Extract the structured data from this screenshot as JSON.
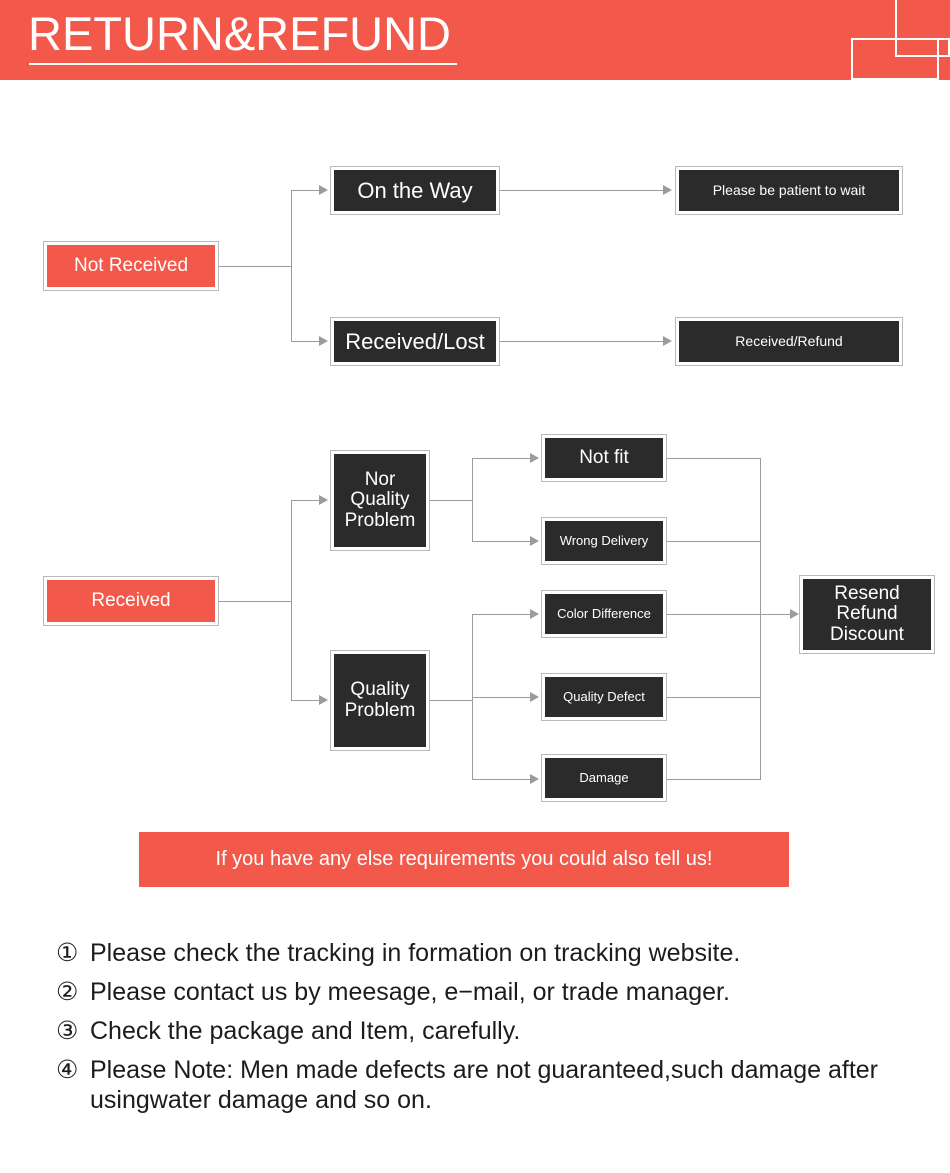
{
  "header": {
    "title": "RETURN&REFUND"
  },
  "flow_not_received": {
    "root": "Not Received",
    "branches": [
      {
        "label": "On the Way",
        "result": "Please be patient to wait"
      },
      {
        "label": "Received/Lost",
        "result": "Received/Refund"
      }
    ]
  },
  "flow_received": {
    "root": "Received",
    "groups": [
      {
        "label": "Nor\nQuality\nProblem",
        "label_lines": [
          "Nor",
          "Quality",
          "Problem"
        ],
        "reasons": [
          "Not fit",
          "Wrong Delivery"
        ]
      },
      {
        "label": "Quality\nProblem",
        "label_lines": [
          "Quality",
          "Problem"
        ],
        "reasons": [
          "Color Difference",
          "Quality Defect",
          "Damage"
        ]
      }
    ],
    "outcome_lines": [
      "Resend",
      "Refund",
      "Discount"
    ],
    "outcome": "Resend Refund Discount"
  },
  "banner": {
    "text": "If you have any else requirements you could also tell us!"
  },
  "notes": [
    {
      "num": "①",
      "text": "Please check the tracking in formation on tracking website."
    },
    {
      "num": "②",
      "text": "Please contact us by meesage, e−mail, or trade manager."
    },
    {
      "num": "③",
      "text": "Check the package and Item, carefully."
    },
    {
      "num": "④",
      "text": "Please Note: Men made defects are not guaranteed,such damage after usingwater damage and so on."
    }
  ],
  "colors": {
    "brand_red": "#f2594b",
    "node_dark": "#2b2b2b",
    "node_border": "#b9b9b9",
    "connector": "#9b9b9b"
  }
}
